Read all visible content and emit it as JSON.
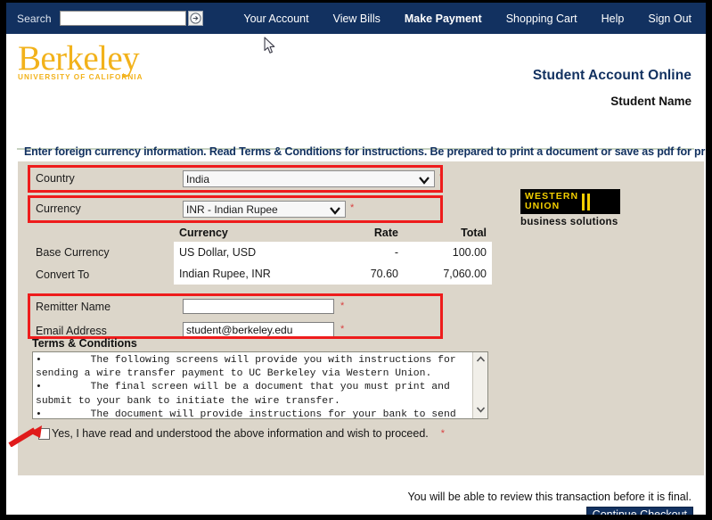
{
  "topnav": {
    "search_label": "Search",
    "search_value": "",
    "search_placeholder": "",
    "go_icon": "arrow-right-circle-icon",
    "links": [
      {
        "label": "Your Account",
        "active": false
      },
      {
        "label": "View Bills",
        "active": false
      },
      {
        "label": "Make Payment",
        "active": true
      },
      {
        "label": "Shopping Cart",
        "active": false
      },
      {
        "label": "Help",
        "active": false
      },
      {
        "label": "Sign Out",
        "active": false
      }
    ]
  },
  "brand": {
    "wordmark": "Berkeley",
    "subwordmark": "UNIVERSITY OF CALIFORNIA",
    "page_title": "Student Account Online",
    "student_name": "Student Name"
  },
  "instruction": "Enter foreign currency information. Read Terms & Conditions for instructions. Be prepared to print a document or save as pdf for printing later.",
  "form": {
    "country": {
      "label": "Country",
      "value": "India",
      "options": [
        "India"
      ],
      "required_mark": "*"
    },
    "currency": {
      "label": "Currency",
      "value": "INR - Indian Rupee",
      "options": [
        "INR - Indian Rupee"
      ],
      "required_mark": "*"
    },
    "remitter_name": {
      "label": "Remitter Name",
      "value": "",
      "required_mark": "*"
    },
    "email_address": {
      "label": "Email Address",
      "value": "student@berkeley.edu",
      "required_mark": "*"
    }
  },
  "conversion_table": {
    "headers": [
      "Currency",
      "Rate",
      "Total"
    ],
    "row_labels": [
      "Base Currency",
      "Convert To"
    ],
    "rows": [
      {
        "currency": "US Dollar, USD",
        "rate": "-",
        "total": "100.00"
      },
      {
        "currency": "Indian Rupee, INR",
        "rate": "70.60",
        "total": "7,060.00"
      }
    ]
  },
  "western_union": {
    "line1": "WESTERN",
    "line2": "UNION",
    "tagline": "business solutions"
  },
  "terms": {
    "title": "Terms & Conditions",
    "body": "•        The following screens will provide you with instructions for\nsending a wire transfer payment to UC Berkeley via Western Union.\n•        The final screen will be a document that you must print and\nsubmit to your bank to initiate the wire transfer.\n•        The document will provide instructions for your bank to send",
    "scroll_up_icon": "chevron-up-icon",
    "scroll_down_icon": "chevron-down-icon"
  },
  "agreement": {
    "checked": false,
    "label": "Yes, I have read and understood the above information and wish to proceed.",
    "required_mark": "*"
  },
  "footer": {
    "note": "You will be able to review this transaction before it is final.",
    "continue_label": "Continue Checkout"
  },
  "colors": {
    "nav_blue": "#123160",
    "brand_gold": "#f2b21b",
    "panel_beige": "#dcd6ca",
    "annotation_red": "#ee1c1c",
    "required_red": "#d94040"
  }
}
